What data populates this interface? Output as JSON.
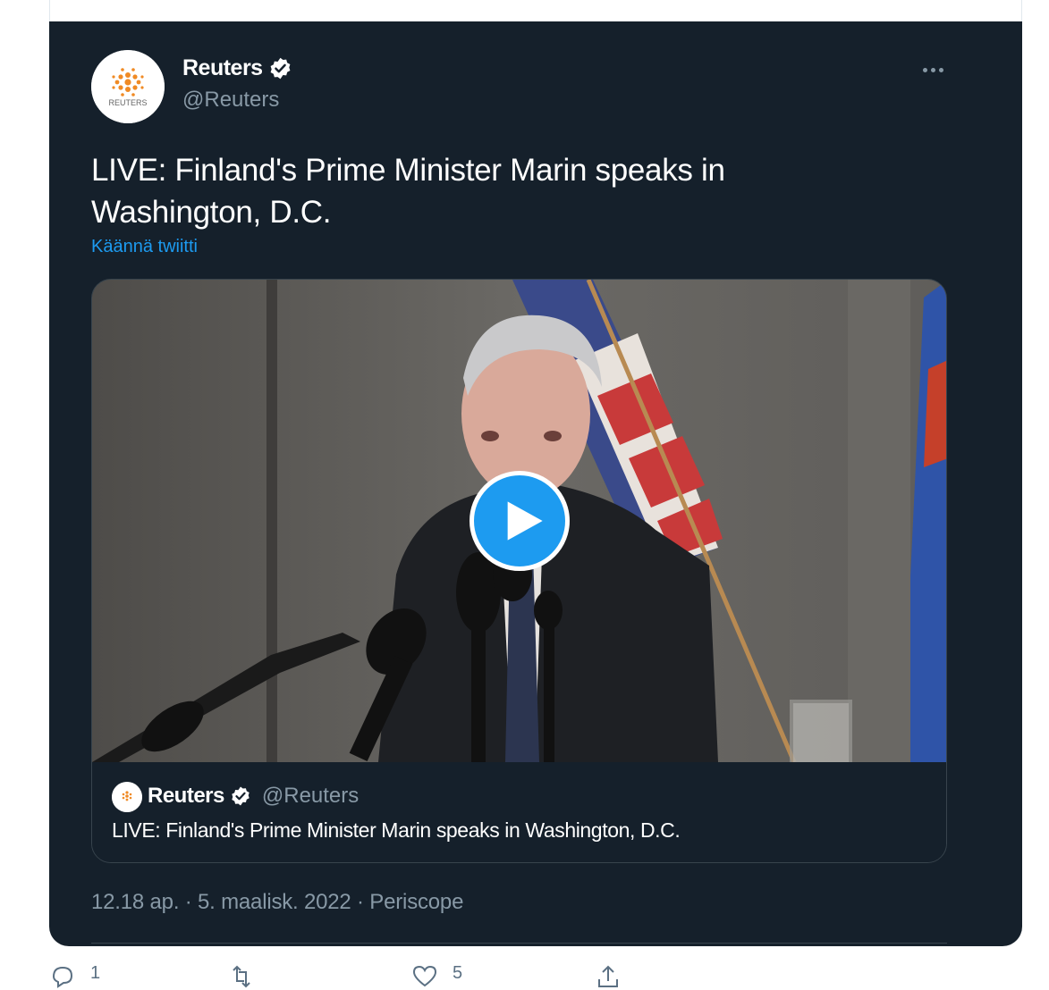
{
  "tweet": {
    "author": {
      "display_name": "Reuters",
      "handle": "@Reuters",
      "verified_icon": "verified-badge-icon"
    },
    "text": "LIVE: Finland's Prime Minister Marin speaks in Washington, D.C.",
    "translate_label": "Käännä twiitti",
    "more_icon": "more-options-icon",
    "media": {
      "play_icon": "play-icon",
      "quote": {
        "display_name": "Reuters",
        "handle": "@Reuters",
        "text": "LIVE: Finland's Prime Minister Marin speaks in Washington, D.C."
      }
    },
    "meta": "12.18 ap. · 5. maalisk. 2022 · Periscope"
  },
  "actions": {
    "reply_count": "1",
    "like_count": "5"
  },
  "colors": {
    "background": "#15202b",
    "accent": "#1d9bf0",
    "secondary_text": "#8899a6",
    "border": "#38444d"
  }
}
